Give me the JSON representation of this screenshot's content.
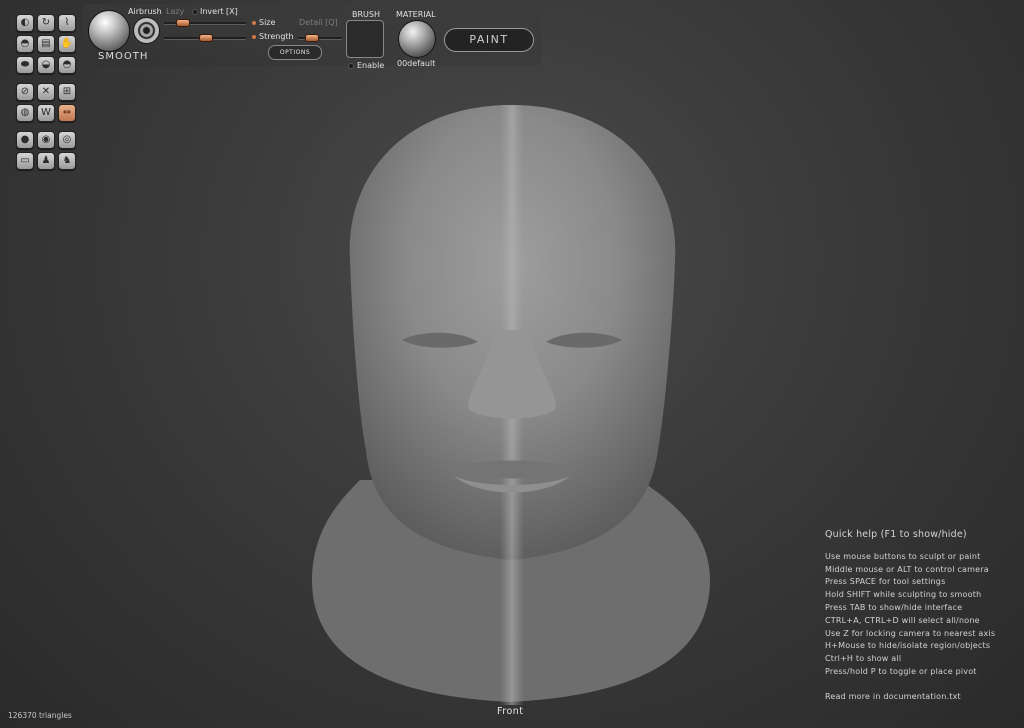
{
  "tools": {
    "rows": [
      [
        "draw-brush-icon",
        "rotate-brush-icon",
        "flatten-brush-icon"
      ],
      [
        "inflate-brush-icon",
        "layer-brush-icon",
        "grab-brush-icon"
      ],
      [
        "crease-brush-icon",
        "clay-brush-icon",
        "pinch-brush-icon"
      ],
      [
        "symmetry-icon",
        "pose-icon",
        "grid-icon"
      ],
      [
        "wireframe-icon",
        "wave-icon",
        "mirror-axis-icon"
      ],
      [
        "camera-icon",
        "view-front-icon",
        "view-side-icon"
      ],
      [
        "body-icon",
        "figure-icon",
        "figure-alt-icon"
      ]
    ],
    "glyphs": {
      "draw-brush-icon": "◐",
      "rotate-brush-icon": "↻",
      "flatten-brush-icon": "⌇",
      "inflate-brush-icon": "◓",
      "layer-brush-icon": "▤",
      "grab-brush-icon": "✋",
      "crease-brush-icon": "⬬",
      "clay-brush-icon": "◒",
      "pinch-brush-icon": "◓",
      "symmetry-icon": "⊘",
      "pose-icon": "✕",
      "grid-icon": "⊞",
      "wireframe-icon": "◍",
      "wave-icon": "W",
      "mirror-axis-icon": "⇔",
      "camera-icon": "●",
      "view-front-icon": "◉",
      "view-side-icon": "◎",
      "body-icon": "▭",
      "figure-icon": "♟",
      "figure-alt-icon": "♞"
    },
    "active": "mirror-axis-icon"
  },
  "brush": {
    "name": "SMOOTH",
    "airbrush_label": "Airbrush",
    "lazy_label": "Lazy",
    "invert_label": "Invert [X]",
    "size_label": "Size",
    "detail_label": "Detail [Q]",
    "strength_label": "Strength",
    "options_label": "OPTIONS"
  },
  "brush_swatch": {
    "heading": "BRUSH",
    "enable_label": "Enable"
  },
  "material": {
    "heading": "MATERIAL",
    "name": "00default"
  },
  "paint_button": "PAINT",
  "viewport": {
    "view_name": "Front",
    "triangle_count": "126370 triangles"
  },
  "quick_help": {
    "title": "Quick help (F1 to show/hide)",
    "lines": [
      "Use mouse buttons to sculpt or paint",
      "Middle mouse or ALT to control camera",
      "Press SPACE for tool settings",
      "Hold SHIFT while sculpting to smooth",
      "Press TAB to show/hide interface",
      "CTRL+A, CTRL+D will select all/none",
      "Use Z for locking camera to nearest axis",
      "H+Mouse to hide/isolate region/objects",
      "Ctrl+H to show all",
      "Press/hold P to toggle or place pivot"
    ],
    "footer": "Read more in documentation.txt"
  }
}
